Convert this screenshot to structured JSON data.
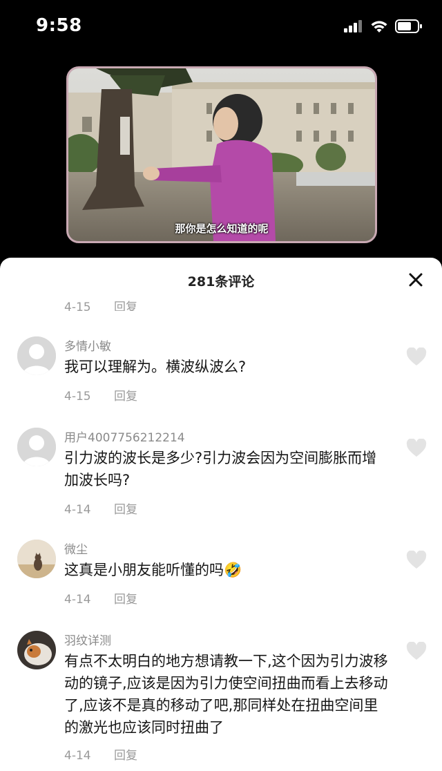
{
  "status_bar": {
    "time": "9:58",
    "icons": [
      "signal-icon",
      "wifi-icon",
      "battery-icon"
    ]
  },
  "video": {
    "subtitle": "那你是怎么知道的呢"
  },
  "comments_sheet": {
    "title": "281条评论",
    "close_icon": "close-icon",
    "peek": {
      "date": "4-15",
      "reply": "回复"
    },
    "comments": [
      {
        "username": "多情小敏",
        "text": "我可以理解为。横波纵波么?",
        "date": "4-15",
        "reply": "回复"
      },
      {
        "username": "用户4007756212214",
        "text": "引力波的波长是多少?引力波会因为空间膨胀而增加波长吗?",
        "date": "4-14",
        "reply": "回复"
      },
      {
        "username": "微尘",
        "text": "这真是小朋友能听懂的吗",
        "emoji": "🤣",
        "date": "4-14",
        "reply": "回复"
      },
      {
        "username": "羽纹详测",
        "text": "有点不太明白的地方想请教一下,这个因为引力波移动的镜子,应该是因为引力使空间扭曲而看上去移动了,应该不是真的移动了吧,那同样处在扭曲空间里的激光也应该同时扭曲了",
        "date": "4-14",
        "reply": "回复"
      }
    ]
  },
  "colors": {
    "background": "#000000",
    "sheet": "#ffffff",
    "meta_text": "#9a9a9a",
    "username_text": "#8a8a8a",
    "like_icon": "#e3e3e3"
  }
}
